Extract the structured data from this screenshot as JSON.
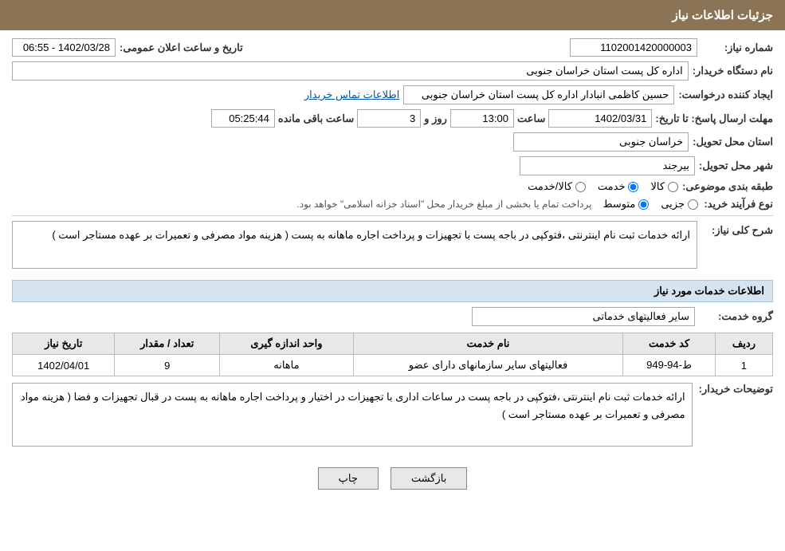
{
  "header": {
    "title": "جزئیات اطلاعات نیاز"
  },
  "need_number": {
    "label": "شماره نیاز:",
    "value": "1102001420000003"
  },
  "announcement_date": {
    "label": "تاریخ و ساعت اعلان عمومی:",
    "value": "1402/03/28 - 06:55"
  },
  "buyer_org": {
    "label": "نام دستگاه خریدار:",
    "value": "اداره کل پست استان خراسان جنوبی"
  },
  "creator": {
    "label": "ایجاد کننده درخواست:",
    "value": "حسین کاظمی انبادار اداره کل پست استان خراسان جنوبی"
  },
  "contact_link": "اطلاعات تماس خریدار",
  "response_deadline": {
    "label": "مهلت ارسال پاسخ: تا تاریخ:",
    "date": "1402/03/31",
    "time_label": "ساعت",
    "time_value": "13:00",
    "day_label": "روز و",
    "day_value": "3",
    "remain_label": "ساعت باقی مانده",
    "remain_value": "05:25:44"
  },
  "province": {
    "label": "استان محل تحویل:",
    "value": "خراسان جنوبی"
  },
  "city": {
    "label": "شهر محل تحویل:",
    "value": "بیرجند"
  },
  "category": {
    "label": "طبقه بندی موضوعی:",
    "options": [
      "کالا",
      "خدمت",
      "کالا/خدمت"
    ],
    "selected": "خدمت"
  },
  "process_type": {
    "label": "نوع فرآیند خرید:",
    "options": [
      "جزیی",
      "متوسط"
    ],
    "note": "پرداخت تمام یا بخشی از مبلغ خریدار محل \"اسناد خزانه اسلامی\" خواهد بود.",
    "selected": "متوسط"
  },
  "general_desc": {
    "label": "شرح کلی نیاز:",
    "value": "ارائه خدمات ثبت نام اینترنتی ،فتوکپی در باجه پست با تجهیزات و پرداخت اجاره ماهانه به پست ( هزینه مواد مصرفی و تعمیرات بر عهده مستاجر است )"
  },
  "service_info_title": "اطلاعات خدمات مورد نیاز",
  "service_group": {
    "label": "گروه خدمت:",
    "value": "سایر فعالیتهای خدماتی"
  },
  "table": {
    "headers": [
      "ردیف",
      "کد خدمت",
      "نام خدمت",
      "واحد اندازه گیری",
      "تعداد / مقدار",
      "تاریخ نیاز"
    ],
    "rows": [
      {
        "row": "1",
        "code": "ط-94-949",
        "name": "فعالیتهای سایر سازمانهای دارای عضو",
        "unit": "ماهانه",
        "qty": "9",
        "date": "1402/04/01"
      }
    ]
  },
  "buyer_desc": {
    "label": "توضیحات خریدار:",
    "value": "ارائه خدمات ثبت نام اینترنتی ،فتوکپی در باجه پست در ساعات اداری با تجهیزات در اختیار و پرداخت اجاره ماهانه به پست در قبال تجهیزات و فضا ( هزینه مواد مصرفی و تعمیرات بر عهده مستاجر است )"
  },
  "buttons": {
    "print": "چاپ",
    "back": "بازگشت"
  }
}
